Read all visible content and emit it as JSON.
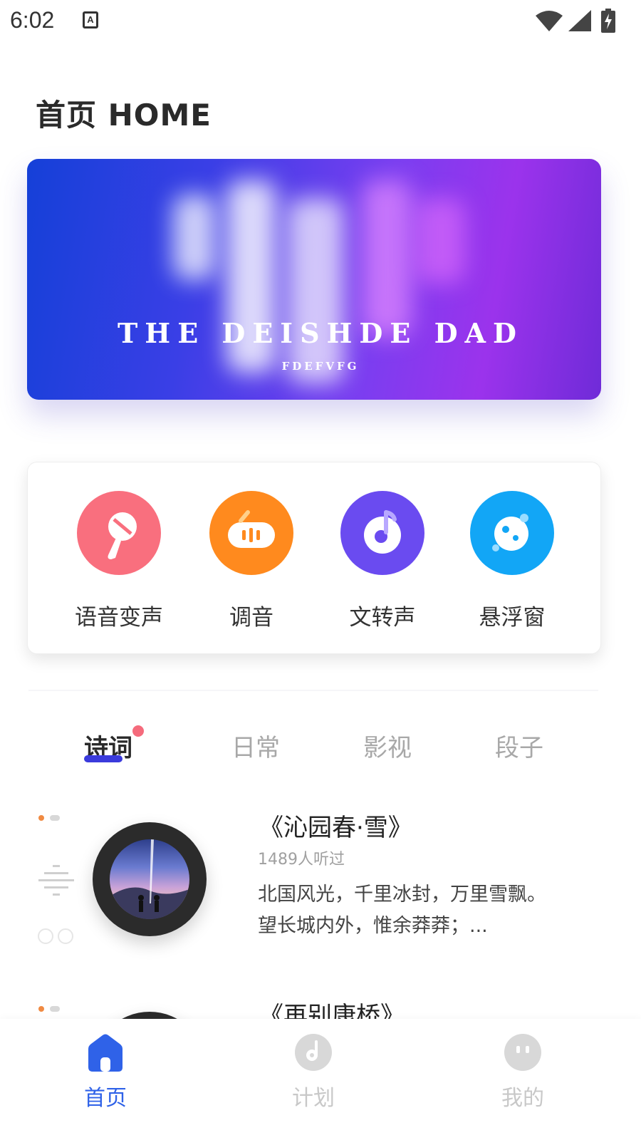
{
  "status_bar": {
    "time": "6:02",
    "notification_letter": "A"
  },
  "page": {
    "title": "首页 HOME"
  },
  "banner": {
    "title": "THE DEISHDE DAD",
    "subtitle": "FDEFVFG"
  },
  "features": [
    {
      "label": "语音变声",
      "icon": "microphone-icon",
      "color": "#f96f7e"
    },
    {
      "label": "调音",
      "icon": "tuner-icon",
      "color": "#ff8a1e"
    },
    {
      "label": "文转声",
      "icon": "music-disc-icon",
      "color": "#6a4bf0"
    },
    {
      "label": "悬浮窗",
      "icon": "planet-icon",
      "color": "#12a6f6"
    }
  ],
  "tabs": [
    {
      "label": "诗词",
      "active": true
    },
    {
      "label": "日常",
      "active": false
    },
    {
      "label": "影视",
      "active": false
    },
    {
      "label": "段子",
      "active": false
    }
  ],
  "list": [
    {
      "title": "《沁园春·雪》",
      "listens": "1489人听过",
      "description_line1": "北国风光，千里冰封，万里雪飘。",
      "description_line2": "望长城内外，惟余莽莽；..."
    },
    {
      "title": "《再别康桥》"
    }
  ],
  "bottom_nav": [
    {
      "label": "首页",
      "icon": "home-icon",
      "active": true
    },
    {
      "label": "计划",
      "icon": "plan-disc-icon",
      "active": false
    },
    {
      "label": "我的",
      "icon": "profile-face-icon",
      "active": false
    }
  ],
  "colors": {
    "accent": "#2f62e8",
    "tab_underline": "#3b3bdc"
  }
}
